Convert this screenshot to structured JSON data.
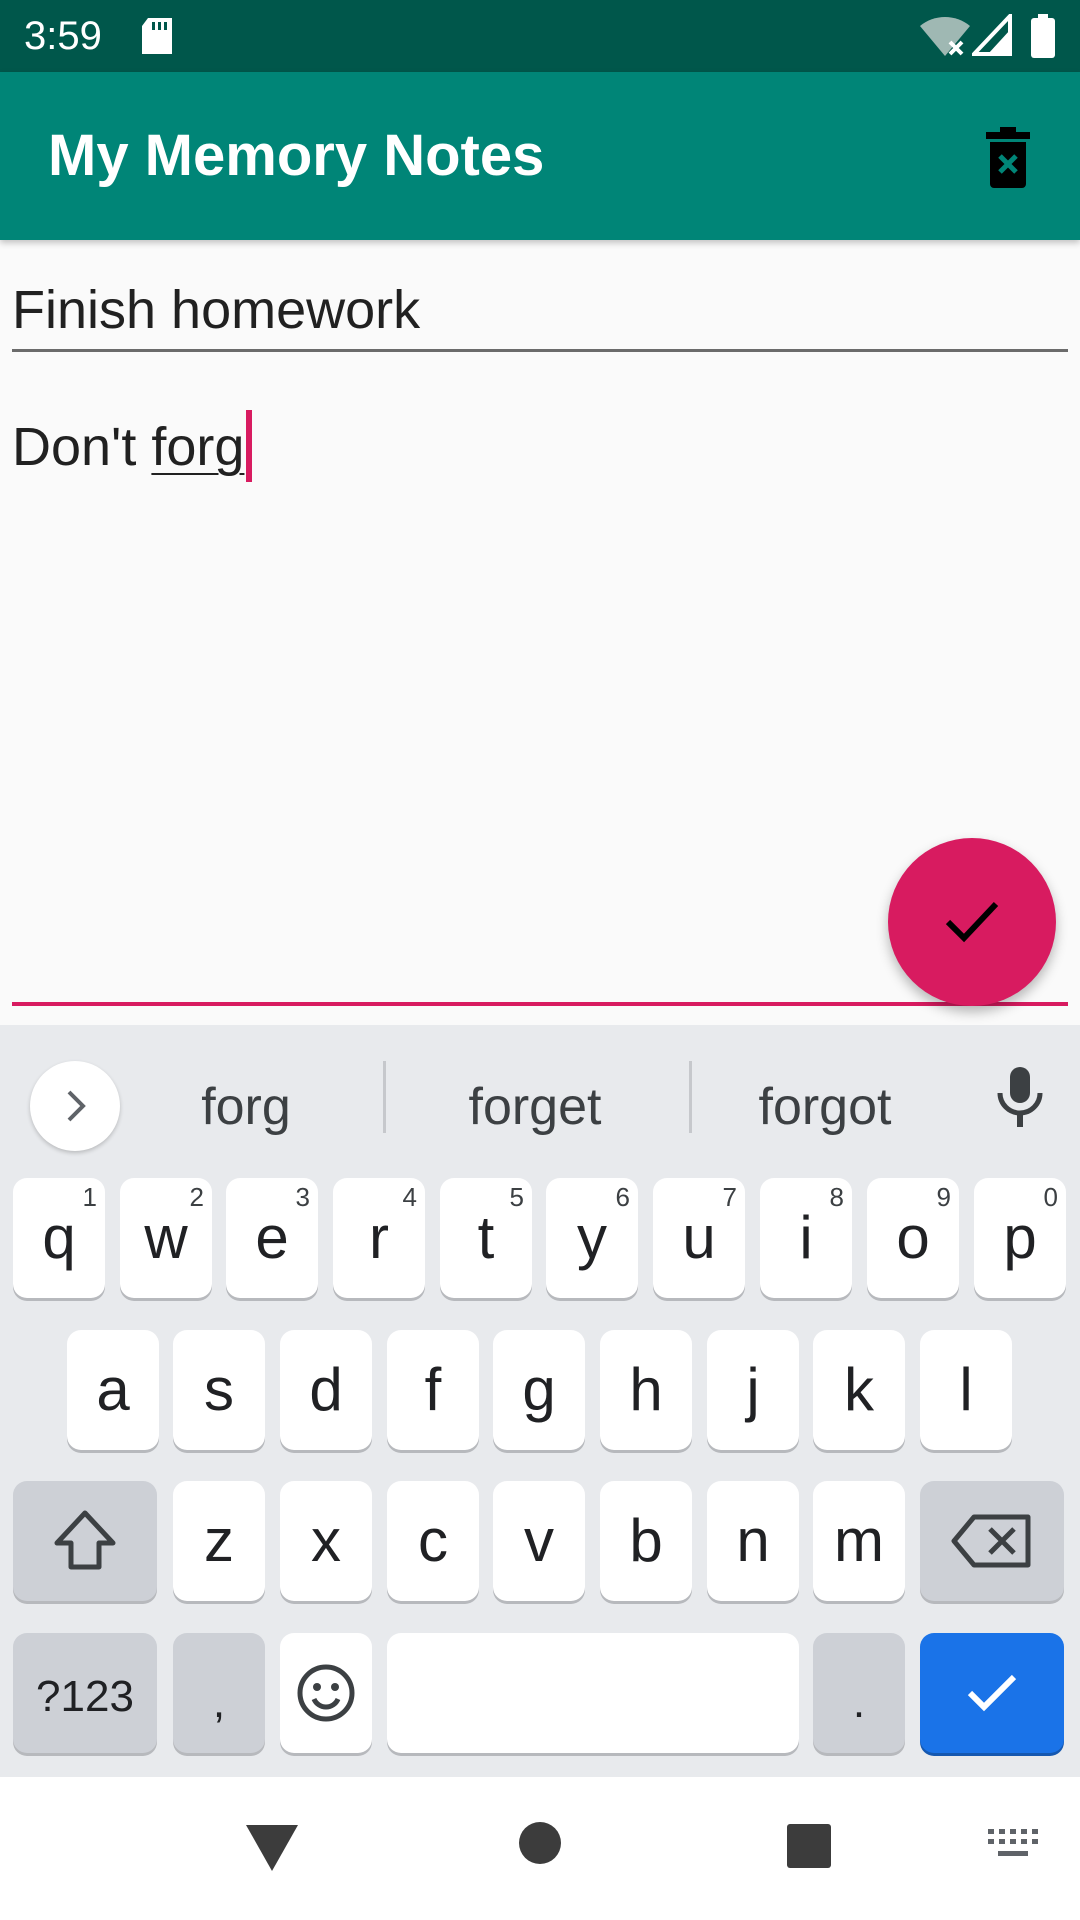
{
  "status_bar": {
    "time": "3:59"
  },
  "app_bar": {
    "title": "My Memory Notes",
    "delete_icon": "delete-forever-icon"
  },
  "note": {
    "title_value": "Finish homework",
    "body_prefix": "Don't ",
    "body_composing": "forg"
  },
  "fab": {
    "icon": "check-icon",
    "color": "#d81b60"
  },
  "keyboard": {
    "suggestions": [
      "forg",
      "forget",
      "forgot"
    ],
    "row1": [
      {
        "ch": "q",
        "hint": "1"
      },
      {
        "ch": "w",
        "hint": "2"
      },
      {
        "ch": "e",
        "hint": "3"
      },
      {
        "ch": "r",
        "hint": "4"
      },
      {
        "ch": "t",
        "hint": "5"
      },
      {
        "ch": "y",
        "hint": "6"
      },
      {
        "ch": "u",
        "hint": "7"
      },
      {
        "ch": "i",
        "hint": "8"
      },
      {
        "ch": "o",
        "hint": "9"
      },
      {
        "ch": "p",
        "hint": "0"
      }
    ],
    "row2": [
      "a",
      "s",
      "d",
      "f",
      "g",
      "h",
      "j",
      "k",
      "l"
    ],
    "row3": [
      "z",
      "x",
      "c",
      "v",
      "b",
      "n",
      "m"
    ],
    "symbols_label": "?123",
    "comma_label": ",",
    "period_label": "."
  },
  "colors": {
    "status_bar": "#00574b",
    "app_bar": "#008577",
    "accent": "#d81b60",
    "enter_key": "#1a73e8"
  }
}
